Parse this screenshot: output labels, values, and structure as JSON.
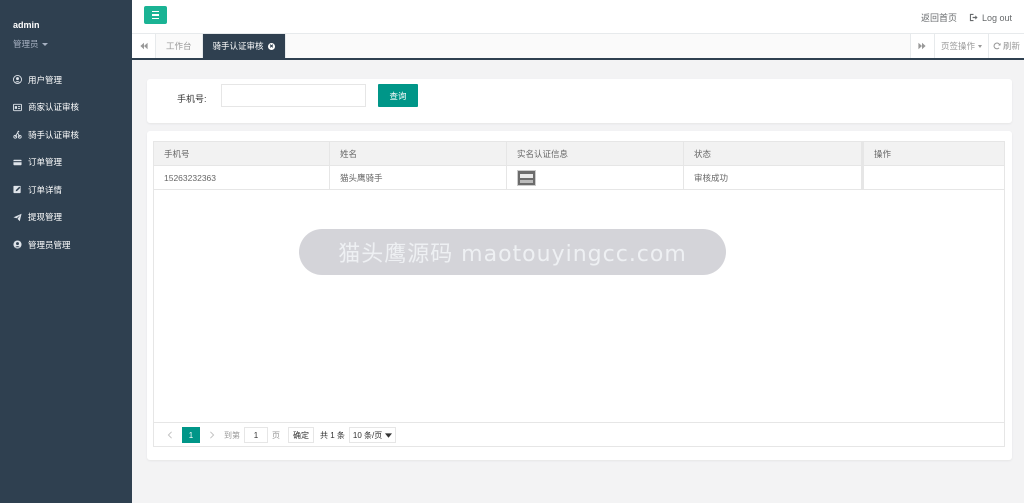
{
  "sidebar": {
    "user_name": "admin",
    "user_role": "管理员",
    "items": [
      {
        "label": "用户管理",
        "icon": "user-circle-icon"
      },
      {
        "label": "商家认证审核",
        "icon": "id-card-icon"
      },
      {
        "label": "骑手认证审核",
        "icon": "rider-icon"
      },
      {
        "label": "订单管理",
        "icon": "credit-card-icon"
      },
      {
        "label": "订单详情",
        "icon": "edit-icon"
      },
      {
        "label": "提现管理",
        "icon": "send-icon"
      },
      {
        "label": "管理员管理",
        "icon": "user-icon"
      }
    ]
  },
  "header": {
    "home_link": "返回首页",
    "logout_label": "Log out"
  },
  "tabs": {
    "items": [
      {
        "label": "工作台",
        "active": false
      },
      {
        "label": "骑手认证审核",
        "active": true
      }
    ],
    "ops_label": "页签操作",
    "refresh_label": "刷新"
  },
  "search": {
    "label": "手机号:",
    "value": "",
    "placeholder": "",
    "button_label": "查询"
  },
  "table": {
    "columns": [
      "手机号",
      "姓名",
      "实名认证信息",
      "状态",
      "操作"
    ],
    "rows": [
      {
        "phone": "15263232363",
        "name": "猫头鹰骑手",
        "id_info": "id-photo-thumbnail",
        "status": "审核成功",
        "action": ""
      }
    ]
  },
  "pagination": {
    "current_page": "1",
    "goto_label": "到第",
    "goto_value": "1",
    "page_unit": "页",
    "confirm_label": "确定",
    "total_label": "共 1 条",
    "page_size_label": "10 条/页"
  },
  "watermark": {
    "text": "猫头鹰源码 maotouyingcc.com"
  },
  "colors": {
    "sidebar_bg": "#2f4050",
    "accent_green": "#1ab394",
    "button_teal": "#009688"
  }
}
